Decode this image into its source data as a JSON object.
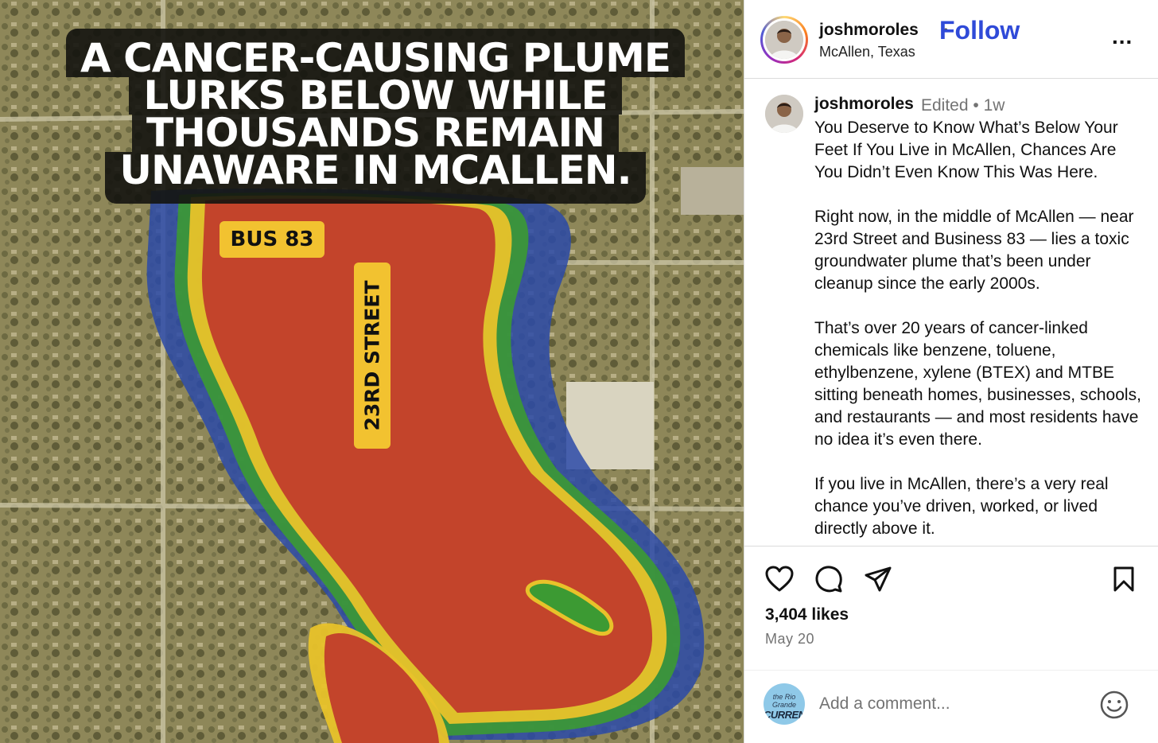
{
  "post_image": {
    "headline": [
      "A CANCER-CAUSING PLUME",
      "LURKS BELOW WHILE",
      "THOUSANDS REMAIN",
      "UNAWARE IN MCALLEN."
    ],
    "labels": {
      "bus": "BUS 83",
      "street": "23RD STREET"
    },
    "colors": {
      "tag": "#f2c230",
      "plume_core": "#c0392b",
      "plume_yellow": "#e8c22a",
      "plume_green": "#3c9a33",
      "plume_blue": "#2b4aa8"
    }
  },
  "header": {
    "username": "joshmoroles",
    "separator": "•",
    "follow_label": "Follow",
    "location": "McAllen, Texas",
    "more_label": "..."
  },
  "caption": {
    "username": "joshmoroles",
    "meta": "Edited • 1w",
    "paragraphs": [
      "You Deserve to Know What’s Below Your Feet If You Live in McAllen, Chances Are You Didn’t Even Know This Was Here.",
      "Right now, in the middle of McAllen — near 23rd Street and Business 83 — lies a toxic groundwater plume that’s been under cleanup since the early 2000s.",
      "That’s over 20 years of cancer-linked chemicals like benzene, toluene, ethylbenzene, xylene (BTEX) and MTBE sitting beneath homes, businesses, schools, and restaurants — and most residents have no idea it’s even there.",
      "If you live in McAllen, there’s a very real chance you’ve driven, worked, or lived directly above it."
    ]
  },
  "actions": {
    "likes": "3,404 likes",
    "date": "May 20"
  },
  "comment": {
    "placeholder": "Add a comment...",
    "commenter_avatar_text": [
      "the Rio Grande",
      "CURRENT"
    ]
  },
  "icons": [
    "heart-icon",
    "comment-icon",
    "share-icon",
    "bookmark-icon",
    "emoji-icon",
    "more-icon"
  ],
  "colors": {
    "follow": "#2f4ad8",
    "muted": "#737373",
    "divider": "#dbdbdb"
  }
}
